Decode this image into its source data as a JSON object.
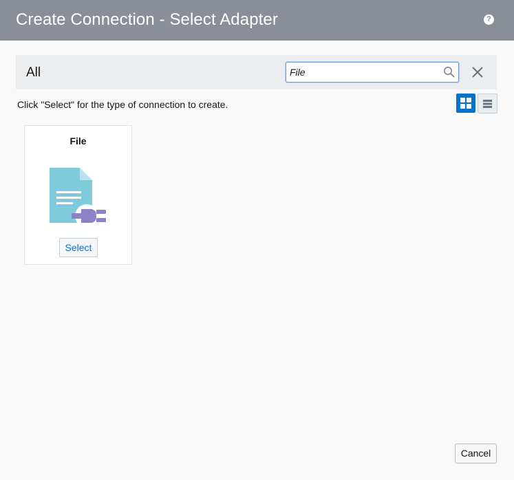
{
  "dialog": {
    "title": "Create Connection - Select Adapter",
    "help_icon": "help-icon",
    "help_glyph": "?"
  },
  "filter": {
    "label": "All",
    "search_value": "File",
    "search_icon": "search-icon",
    "clear_icon": "close-icon"
  },
  "instructions": "Click \"Select\" for the type of connection to create.",
  "view_toggle": {
    "grid_icon": "grid-view-icon",
    "list_icon": "list-view-icon",
    "active": "grid"
  },
  "adapters": [
    {
      "name": "File",
      "icon": "file-adapter-icon",
      "select_label": "Select"
    }
  ],
  "footer": {
    "cancel_label": "Cancel"
  },
  "colors": {
    "titlebar": "#8a8e98",
    "accent": "#0572ce",
    "file_icon": "#7fcbdc",
    "plug_icon": "#8e82c7"
  }
}
